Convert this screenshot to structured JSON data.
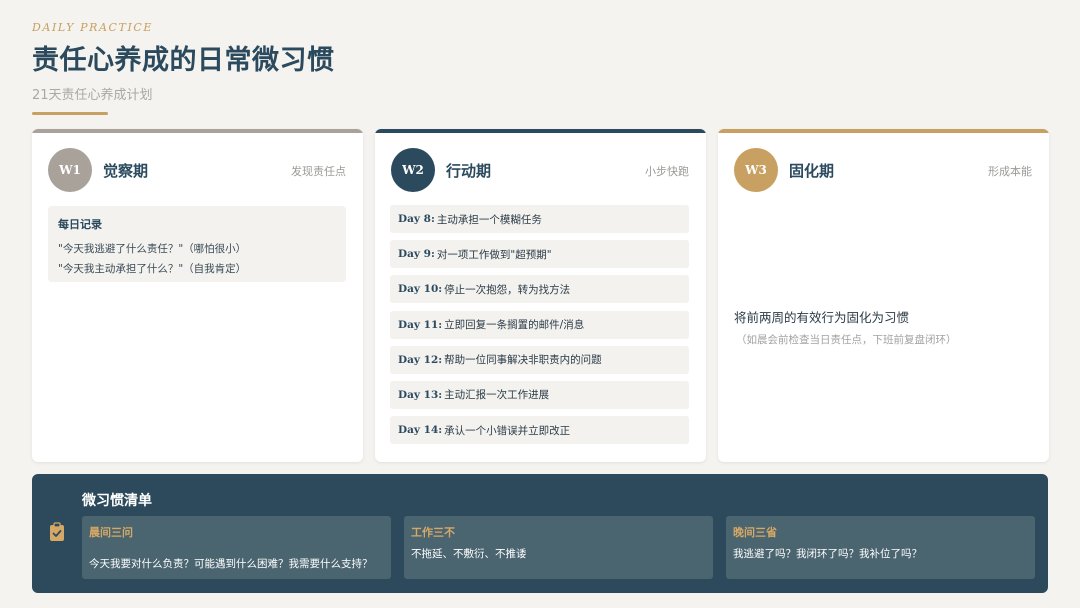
{
  "header": {
    "eyebrow": "DAILY PRACTICE",
    "title": "责任心养成的日常微习惯",
    "subtitle": "21天责任心养成计划"
  },
  "colors": {
    "accent_gold": "#c8a062",
    "navy": "#2b4a5e",
    "taupe": "#a8a29a",
    "background": "#f4f3ef"
  },
  "weeks": [
    {
      "badge": "W1",
      "name": "觉察期",
      "tag": "发现责任点",
      "record": {
        "title": "每日记录",
        "lines": [
          "\"今天我逃避了什么责任？\"（哪怕很小）",
          "\"今天我主动承担了什么？\"（自我肯定）"
        ]
      }
    },
    {
      "badge": "W2",
      "name": "行动期",
      "tag": "小步快跑",
      "tasks": [
        {
          "day": "Day 8:",
          "text": "主动承担一个模糊任务"
        },
        {
          "day": "Day 9:",
          "text": "对一项工作做到\"超预期\""
        },
        {
          "day": "Day 10:",
          "text": "停止一次抱怨，转为找方法"
        },
        {
          "day": "Day 11:",
          "text": "立即回复一条搁置的邮件/消息"
        },
        {
          "day": "Day 12:",
          "text": "帮助一位同事解决非职责内的问题"
        },
        {
          "day": "Day 13:",
          "text": "主动汇报一次工作进展"
        },
        {
          "day": "Day 14:",
          "text": "承认一个小错误并立即改正"
        }
      ]
    },
    {
      "badge": "W3",
      "name": "固化期",
      "tag": "形成本能",
      "main": "将前两周的有效行为固化为习惯",
      "sub": "（如晨会前检查当日责任点，下班前复盘闭环）"
    }
  ],
  "checklist": {
    "icon": "clipboard-check-icon",
    "title": "微习惯清单",
    "items": [
      {
        "label": "晨间三问",
        "text": "今天我要对什么负责？可能遇到什么困难？我需要什么支持？"
      },
      {
        "label": "工作三不",
        "text": "不拖延、不敷衍、不推诿"
      },
      {
        "label": "晚间三省",
        "text": "我逃避了吗？我闭环了吗？我补位了吗？"
      }
    ]
  }
}
